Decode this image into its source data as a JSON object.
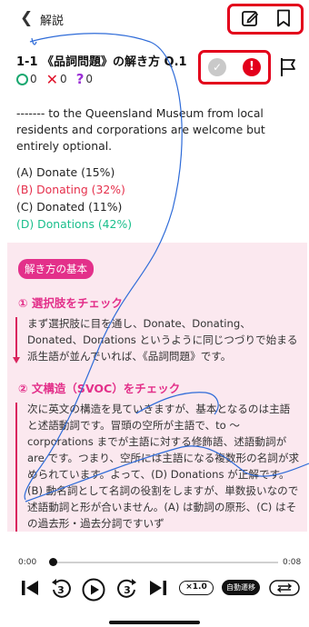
{
  "header": {
    "back_label": "解説",
    "back_icon": "chevron-left-icon",
    "edit_icon": "edit-note-icon",
    "bookmark_icon": "bookmark-icon",
    "highlight_color": "#e3001b"
  },
  "question": {
    "title": "1-1 《品詞問題》の解き方 Q.1",
    "stats": {
      "correct": "0",
      "wrong": "0",
      "unsure": "0"
    },
    "text": "------- to the Queensland Museum from local residents and corporations are welcome but entirely optional.",
    "choices": [
      {
        "label": "(A) Donate (15%)",
        "state": "normal"
      },
      {
        "label": "(B) Donating (32%)",
        "state": "wrong"
      },
      {
        "label": "(C) Donated (11%)",
        "state": "normal"
      },
      {
        "label": "(D) Donations (42%)",
        "state": "correct"
      }
    ],
    "status_icons": [
      "check-circle-icon",
      "alert-circle-icon"
    ],
    "flag_icon": "flag-icon"
  },
  "explanation": {
    "badge": "解き方の基本",
    "sections": [
      {
        "title": "① 選択肢をチェック",
        "body": "まず選択肢に目を通し、Donate、Donating、Donated、Donations というように同じつづりで始まる派生語が並んでいれば、《品詞問題》です。"
      },
      {
        "title": "② 文構造（SVOC）をチェック",
        "body": "次に英文の構造を見ていきますが、基本となるのは主語と述語動詞です。冒頭の空所が主語で、to ～ corporations までが主語に対する修飾語、述語動詞が are です。つまり、空所には主語になる複数形の名詞が求められています。よって、(D) Donations が正解です。(B) 動名詞として名詞の役割をしますが、単数扱いなので述語動詞と形が合いません。(A) は動詞の原形、(C) はその過去形・過去分詞ですいず"
      }
    ],
    "accent_color": "#e3308a",
    "background": "#fbe8ef"
  },
  "player": {
    "current_time": "0:00",
    "total_time": "0:08",
    "progress": 0.0,
    "speed": "×1.0",
    "auto_label": "自動遷移",
    "icons": [
      "skip-previous-icon",
      "rewind-3-icon",
      "play-icon",
      "forward-3-icon",
      "skip-next-icon",
      "repeat-icon"
    ]
  }
}
